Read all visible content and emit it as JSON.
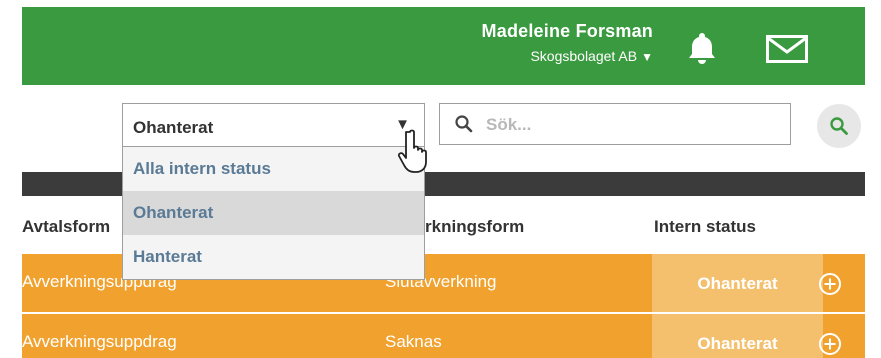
{
  "header": {
    "user_name": "Madeleine Forsman",
    "organization": "Skogsbolaget AB",
    "org_caret": "▼",
    "bell_icon": "bell-icon",
    "mail_icon": "mail-icon",
    "bg_color": "#3a9a3f"
  },
  "filter": {
    "selected": "Ohanterat",
    "caret": "▼",
    "options": [
      "Alla intern status",
      "Ohanterat",
      "Hanterat"
    ],
    "highlighted_index": 1
  },
  "search": {
    "placeholder": "Sök...",
    "value": ""
  },
  "table": {
    "columns": [
      "Avtalsform",
      "Avverkningsform",
      "Intern status"
    ],
    "rows": [
      {
        "avtalsform": "Avverkningsuppdrag",
        "avverkningsform": "Slutavverkning",
        "status": "Ohanterat"
      },
      {
        "avtalsform": "Avverkningsuppdrag",
        "avverkningsform": "Saknas",
        "status": "Ohanterat"
      }
    ],
    "row_color": "#f0a12e",
    "status_color": "#f5c06e"
  }
}
